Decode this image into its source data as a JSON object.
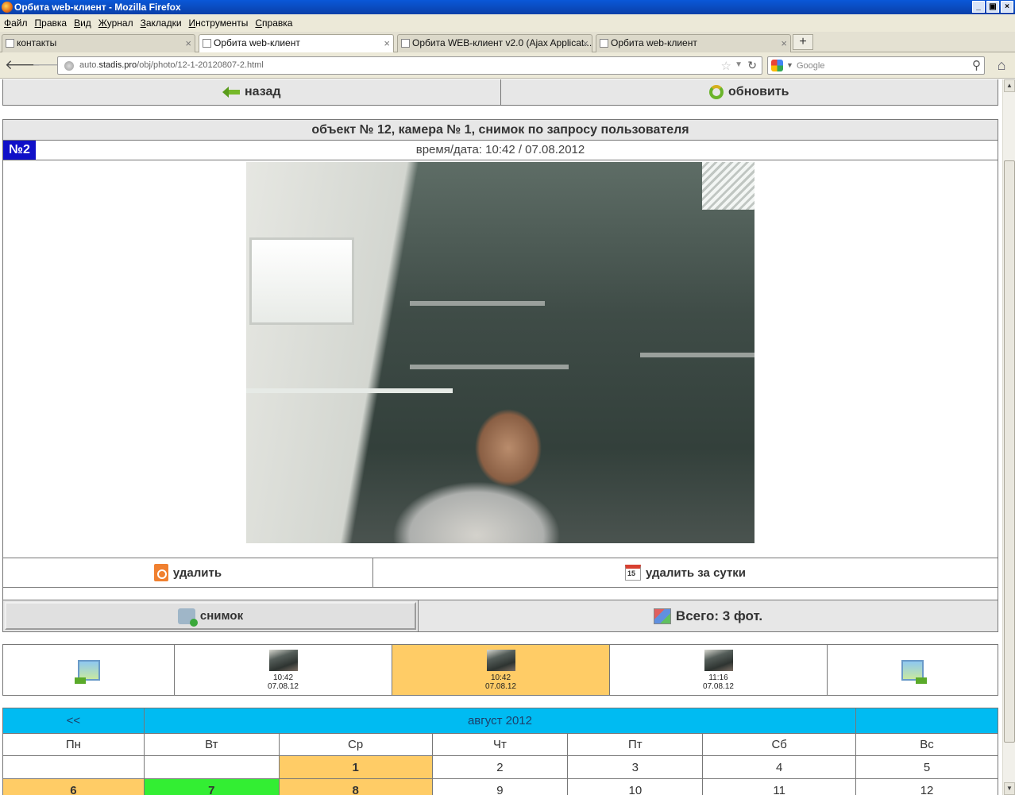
{
  "window": {
    "title": "Орбита web-клиент - Mozilla Firefox"
  },
  "menu": [
    "Файл",
    "Правка",
    "Вид",
    "Журнал",
    "Закладки",
    "Инструменты",
    "Справка"
  ],
  "tabs": [
    {
      "label": "контакты",
      "active": false
    },
    {
      "label": "Орбита web-клиент",
      "active": true
    },
    {
      "label": "Орбита WEB-клиент v2.0 (Ajax Applicat...",
      "active": false
    },
    {
      "label": "Орбита web-клиент",
      "active": false
    }
  ],
  "nav": {
    "url_prefix": "auto.",
    "url_domain": "stadis.pro",
    "url_path": "/obj/photo/12-1-20120807-2.html",
    "search_placeholder": "Google"
  },
  "toolbar": {
    "back_label": "назад",
    "refresh_label": "обновить"
  },
  "photo": {
    "title": "объект № 12, камера № 1, снимок по запросу пользователя",
    "number": "№2",
    "datetime": "время/дата: 10:42 / 07.08.2012"
  },
  "actions": {
    "delete_label": "удалить",
    "delete_day_label": "удалить за сутки"
  },
  "snapshot": {
    "button_label": "снимок",
    "total_label": "Всего: 3 фот."
  },
  "thumbnails": [
    {
      "time": "10:42",
      "date": "07.08.12",
      "selected": false
    },
    {
      "time": "10:42",
      "date": "07.08.12",
      "selected": true
    },
    {
      "time": "11:16",
      "date": "07.08.12",
      "selected": false
    }
  ],
  "calendar": {
    "prev_label": "<<",
    "month_label": "август 2012",
    "weekdays": [
      "Пн",
      "Вт",
      "Ср",
      "Чт",
      "Пт",
      "Сб",
      "Вс"
    ],
    "week1": [
      "",
      "",
      "1",
      "2",
      "3",
      "4",
      "5"
    ],
    "week2": [
      "6",
      "7",
      "8",
      "9",
      "10",
      "11",
      "12"
    ]
  },
  "colors": {
    "header_blue": "#00bbf2",
    "highlight": "#ffcc66",
    "green_day": "#33ee33",
    "number_badge": "#1010c8"
  }
}
